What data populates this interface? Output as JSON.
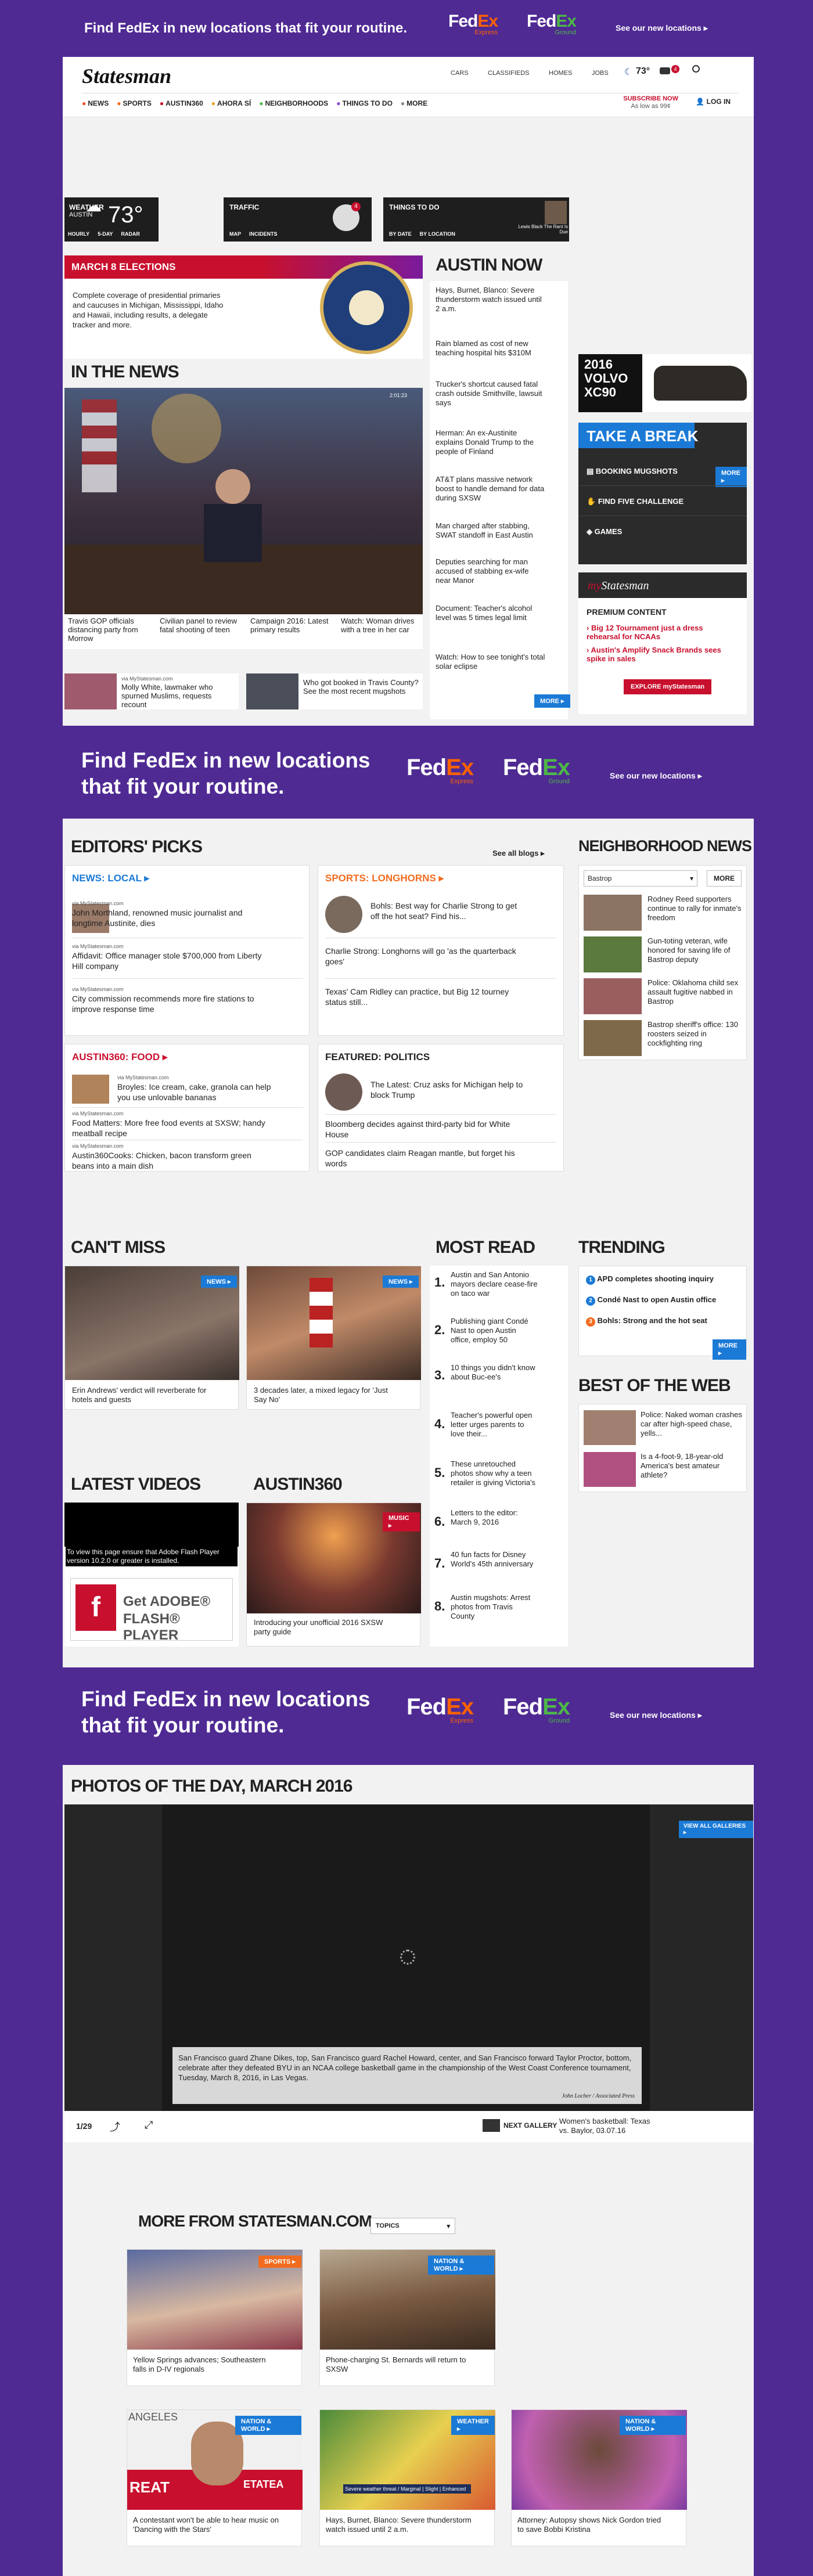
{
  "fedex": {
    "headline": "Find FedEx in new locations that fit your routine.",
    "headline_line1": "Find FedEx in new locations",
    "headline_line2": "that fit your routine.",
    "fe": "Fed",
    "ex": "Ex",
    "express": "Express",
    "ground": "Ground",
    "cta": "See our new locations ▸"
  },
  "header": {
    "logo": "Statesman",
    "top_links": [
      "CARS",
      "CLASSIFIEDS",
      "HOMES",
      "JOBS"
    ],
    "temp": "73°",
    "traffic_count": "4",
    "nav": [
      "NEWS",
      "SPORTS",
      "AUSTIN360",
      "AHORA SÍ",
      "NEIGHBORHOODS",
      "THINGS TO DO",
      "MORE"
    ],
    "subscribe": "SUBSCRIBE NOW",
    "subscribe_sub": "As low as 99¢",
    "login": "LOG IN"
  },
  "widgets": {
    "weather_label": "WEATHER",
    "weather_city": "AUSTIN",
    "weather_temp": "73°",
    "weather_tabs": [
      "HOURLY",
      "5-DAY",
      "RADAR"
    ],
    "traffic_label": "TRAFFIC",
    "traffic_tabs": [
      "MAP",
      "INCIDENTS"
    ],
    "traffic_count": "4",
    "ttd_label": "THINGS TO DO",
    "ttd_tabs": [
      "BY DATE",
      "BY LOCATION"
    ],
    "ttd_caption": "Lewis Black The Rant Is Due"
  },
  "elections": {
    "title": "MARCH 8 ELECTIONS",
    "text": "Complete coverage of presidential primaries and caucuses in Michigan, Mississippi, Idaho and Hawaii, including results, a delegate tracker and more.",
    "seal": "EXECUTIVE OFFICE OF THE PRESIDENT"
  },
  "in_the_news": {
    "title": "IN THE NEWS",
    "photo_time": "2:01:23",
    "items": [
      "Travis GOP officials distancing party from Morrow",
      "Civilian panel to review fatal shooting of teen",
      "Campaign 2016: Latest primary results",
      "Watch: Woman drives with a tree in her car"
    ],
    "lower": [
      {
        "src": "via MyStatesman.com",
        "text": "Molly White, lawmaker who spurned Muslims, requests recount"
      },
      {
        "src": "",
        "text": "Who got booked in Travis County? See the most recent mugshots"
      }
    ]
  },
  "austin_now": {
    "title": "AUSTIN NOW",
    "items": [
      "Hays, Burnet, Blanco: Severe thunderstorm watch issued until 2 a.m.",
      "Rain blamed as cost of new teaching hospital hits $310M",
      "Trucker's shortcut caused fatal crash outside Smithville, lawsuit says",
      "Herman: An ex-Austinite explains Donald Trump to the people of Finland",
      "AT&T plans massive network boost to handle demand for data during SXSW",
      "Man charged after stabbing, SWAT standoff in East Austin",
      "Deputies searching for man accused of stabbing ex-wife near Manor",
      "Document: Teacher's alcohol level was 5 times legal limit",
      "Watch: How to see tonight's total solar eclipse"
    ],
    "more": "MORE ▸"
  },
  "ad_volvo": {
    "line1": "2016",
    "line2": "VOLVO",
    "line3": "XC90"
  },
  "take_a_break": {
    "title": "TAKE A BREAK",
    "items": [
      "BOOKING MUGSHOTS",
      "FIND FIVE CHALLENGE",
      "GAMES"
    ],
    "more": "MORE ▸"
  },
  "mystatesman": {
    "logo_my": "my",
    "logo_statesman": "Statesman",
    "premium": "PREMIUM CONTENT",
    "items": [
      "Big 12 Tournament just a dress rehearsal for NCAAs",
      "Austin's Amplify Snack Brands sees spike in sales"
    ],
    "button": "EXPLORE myStatesman"
  },
  "editors_picks": {
    "title": "EDITORS' PICKS",
    "see_all": "See all blogs ▸",
    "boxes": [
      {
        "title": "NEWS: LOCAL ▸",
        "items": [
          {
            "src": "via MyStatesman.com",
            "text": "John Morthland, renowned music journalist and longtime Austinite, dies"
          },
          {
            "src": "via MyStatesman.com",
            "text": "Affidavit: Office manager stole $700,000 from Liberty Hill company"
          },
          {
            "src": "via MyStatesman.com",
            "text": "City commission recommends more fire stations to improve response time"
          }
        ]
      },
      {
        "title": "SPORTS: LONGHORNS ▸",
        "items": [
          {
            "src": "",
            "text": "Bohls: Best way for Charlie Strong to get off the hot seat? Find his..."
          },
          {
            "src": "",
            "text": "Charlie Strong: Longhorns will go 'as the quarterback goes'"
          },
          {
            "src": "",
            "text": "Texas' Cam Ridley can practice, but Big 12 tourney status still..."
          }
        ]
      },
      {
        "title": "AUSTIN360: FOOD ▸",
        "items": [
          {
            "src": "via MyStatesman.com",
            "text": "Broyles: Ice cream, cake, granola can help you use unlovable bananas"
          },
          {
            "src": "via MyStatesman.com",
            "text": "Food Matters: More free food events at SXSW; handy meatball recipe"
          },
          {
            "src": "via MyStatesman.com",
            "text": "Austin360Cooks: Chicken, bacon transform green beans into a main dish"
          }
        ]
      },
      {
        "title": "FEATURED: POLITICS",
        "items": [
          {
            "src": "",
            "text": "The Latest: Cruz asks for Michigan help to block Trump"
          },
          {
            "src": "",
            "text": "Bloomberg decides against third-party bid for White House"
          },
          {
            "src": "",
            "text": "GOP candidates claim Reagan mantle, but forget his words"
          }
        ]
      }
    ]
  },
  "neighborhood": {
    "title": "NEIGHBORHOOD NEWS",
    "select": "Bastrop",
    "more": "MORE",
    "items": [
      "Rodney Reed supporters continue to rally for inmate's freedom",
      "Gun-toting veteran, wife honored for saving life of Bastrop deputy",
      "Police: Oklahoma child sex assault fugitive nabbed in Bastrop",
      "Bastrop sheriff's office: 130 roosters seized in cockfighting ring"
    ]
  },
  "cant_miss": {
    "title": "CAN'T MISS",
    "items": [
      {
        "badge": "NEWS ▸",
        "text": "Erin Andrews' verdict will reverberate for hotels and guests"
      },
      {
        "badge": "NEWS ▸",
        "text": "3 decades later, a mixed legacy for 'Just Say No'"
      }
    ]
  },
  "most_read": {
    "title": "MOST READ",
    "items": [
      "Austin and San Antonio mayors declare cease-fire on taco war",
      "Publishing giant Condé Nast to open Austin office, employ 50",
      "10 things you didn't know about Buc-ee's",
      "Teacher's powerful open letter urges parents to love their...",
      "These unretouched photos show why a teen retailer is giving Victoria's",
      "Letters to the editor: March 9, 2016",
      "40 fun facts for Disney World's 45th anniversary",
      "Austin mugshots: Arrest photos from Travis County"
    ]
  },
  "trending": {
    "title": "TRENDING",
    "items": [
      "APD completes shooting inquiry",
      "Condé Nast to open Austin office",
      "Bohls: Strong and the hot seat"
    ],
    "more": "MORE ▸"
  },
  "best_of_web": {
    "title": "BEST OF THE WEB",
    "items": [
      "Police: Naked woman crashes car after high-speed chase, yells...",
      "Is a 4-foot-9, 18-year-old America's best amateur athlete?"
    ]
  },
  "latest_videos": {
    "title": "LATEST VIDEOS",
    "flash_msg": "To view this page ensure that Adobe Flash Player version 10.2.0 or greater is installed.",
    "flash_get": "Get ADOBE®",
    "flash_player": "FLASH® PLAYER"
  },
  "austin360": {
    "title": "AUSTIN360",
    "badge": "MUSIC ▸",
    "text": "Introducing your unofficial 2016 SXSW party guide"
  },
  "photos": {
    "title": "PHOTOS OF THE DAY, MARCH 2016",
    "view_all": "VIEW ALL GALLERIES ▸",
    "caption": "San Francisco guard Zhane Dikes, top, San Francisco guard Rachel Howard, center, and San Francisco forward Taylor Proctor, bottom, celebrate after they defeated BYU in an NCAA college basketball game in the championship of the West Coast Conference tournament, Tuesday, March 8, 2016, in Las Vegas.",
    "credit": "John Locher / Associated Press",
    "counter": "1/29",
    "next_gallery": "NEXT GALLERY",
    "next_title": "Women's basketball: Texas vs. Baylor, 03.07.16"
  },
  "more_from": {
    "title": "MORE FROM STATESMAN.COM",
    "select": "TOPICS",
    "items": [
      {
        "badge": "SPORTS ▸",
        "text": "Yellow Springs advances; Southeastern falls in D-IV regionals"
      },
      {
        "badge": "NATION & WORLD ▸",
        "text": "Phone-charging St. Bernards will return to SXSW"
      },
      {
        "badge": "NATION & WORLD ▸",
        "text": "A contestant won't be able to hear music on 'Dancing with the Stars'"
      },
      {
        "badge": "WEATHER ▸",
        "text": "Hays, Burnet, Blanco: Severe thunderstorm watch issued until 2 a.m."
      },
      {
        "badge": "NATION & WORLD ▸",
        "text": "Attorney: Autopsy shows Nick Gordon tried to save Bobbi Kristina"
      }
    ],
    "photo_text": [
      "ANGELES",
      "REAT",
      "ETATEA"
    ],
    "weather_map_text": "Severe weather threat / Marginal | Slight | Enhanced"
  },
  "colors": {
    "fedex_purple": "#4f2a93",
    "fedex_orange": "#ff6200",
    "fedex_green": "#4db848",
    "accent_blue": "#1b7ad6",
    "accent_red": "#c8102e",
    "sports_orange": "#f26c1f"
  }
}
